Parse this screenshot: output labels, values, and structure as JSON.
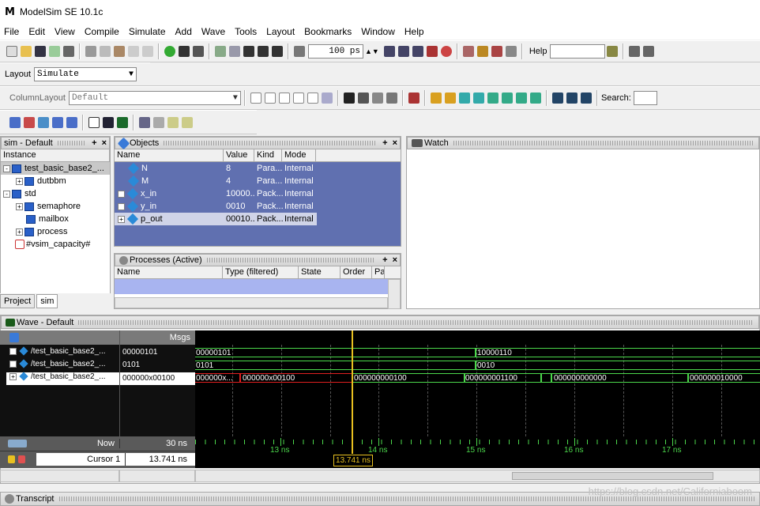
{
  "window": {
    "logo": "M",
    "title": "ModelSim SE 10.1c"
  },
  "menu": [
    "File",
    "Edit",
    "View",
    "Compile",
    "Simulate",
    "Add",
    "Wave",
    "Tools",
    "Layout",
    "Bookmarks",
    "Window",
    "Help"
  ],
  "toolbar1": {
    "runtime": "100 ps",
    "help_label": "Help",
    "help_value": ""
  },
  "toolbar2": {
    "layout_label": "Layout",
    "layout_value": "Simulate"
  },
  "toolbar3": {
    "columnlayout_label": "ColumnLayout",
    "columnlayout_value": "Default",
    "search_label": "Search:"
  },
  "sim_pane": {
    "title": "sim - Default",
    "column": "Instance",
    "items": [
      {
        "label": "test_basic_base2_...",
        "indent": 0,
        "expand": "-",
        "selected": true
      },
      {
        "label": "dutbbm",
        "indent": 1,
        "expand": "+"
      },
      {
        "label": "std",
        "indent": 0,
        "expand": "-"
      },
      {
        "label": "semaphore",
        "indent": 1,
        "expand": "+"
      },
      {
        "label": "mailbox",
        "indent": 1,
        "expand": ""
      },
      {
        "label": "process",
        "indent": 1,
        "expand": "+"
      },
      {
        "label": "#vsim_capacity#",
        "indent": 0,
        "expand": "",
        "chart": true
      }
    ],
    "tabs": [
      "Project",
      "sim"
    ]
  },
  "objects_pane": {
    "title": "Objects",
    "columns": [
      "Name",
      "Value",
      "Kind",
      "Mode"
    ],
    "rows": [
      {
        "name": "N",
        "value": "8",
        "kind": "Para...",
        "mode": "Internal",
        "expand": ""
      },
      {
        "name": "M",
        "value": "4",
        "kind": "Para...",
        "mode": "Internal",
        "expand": ""
      },
      {
        "name": "x_in",
        "value": "10000...",
        "kind": "Pack...",
        "mode": "Internal",
        "expand": "+"
      },
      {
        "name": "y_in",
        "value": "0010",
        "kind": "Pack...",
        "mode": "Internal",
        "expand": "+"
      },
      {
        "name": "p_out",
        "value": "00010...",
        "kind": "Pack...",
        "mode": "Internal",
        "expand": "+"
      }
    ]
  },
  "processes_pane": {
    "title": "Processes (Active)",
    "columns": [
      "Name",
      "Type (filtered)",
      "State",
      "Order",
      "Par"
    ]
  },
  "watch_pane": {
    "title": "Watch"
  },
  "wave": {
    "title": "Wave - Default",
    "msgs_header": "Msgs",
    "signals": [
      {
        "name": "/test_basic_base2_...",
        "value": "00000101"
      },
      {
        "name": "/test_basic_base2_...",
        "value": "0101"
      },
      {
        "name": "/test_basic_base2_...",
        "value": "000000x00100"
      }
    ],
    "now_label": "Now",
    "now_value": "30 ns",
    "cursor_label": "Cursor 1",
    "cursor_value": "13.741 ns",
    "cursor_flag": "13.741 ns",
    "ticks": [
      "13 ns",
      "14 ns",
      "15 ns",
      "16 ns",
      "17 ns"
    ],
    "row1": [
      "00000101",
      "10000110"
    ],
    "row2": [
      "0101",
      "0010"
    ],
    "row3": [
      "000000x...",
      "000000x00100",
      "000000000100",
      "000000001100",
      "000000000000",
      "000000010000"
    ],
    "colors": {
      "signal_green": "#4cd84c",
      "signal_red": "#e02020",
      "cursor": "#e8c020"
    }
  },
  "transcript": {
    "title": "Transcript"
  },
  "watermark": "https://blog.csdn.net/Californiaboom"
}
